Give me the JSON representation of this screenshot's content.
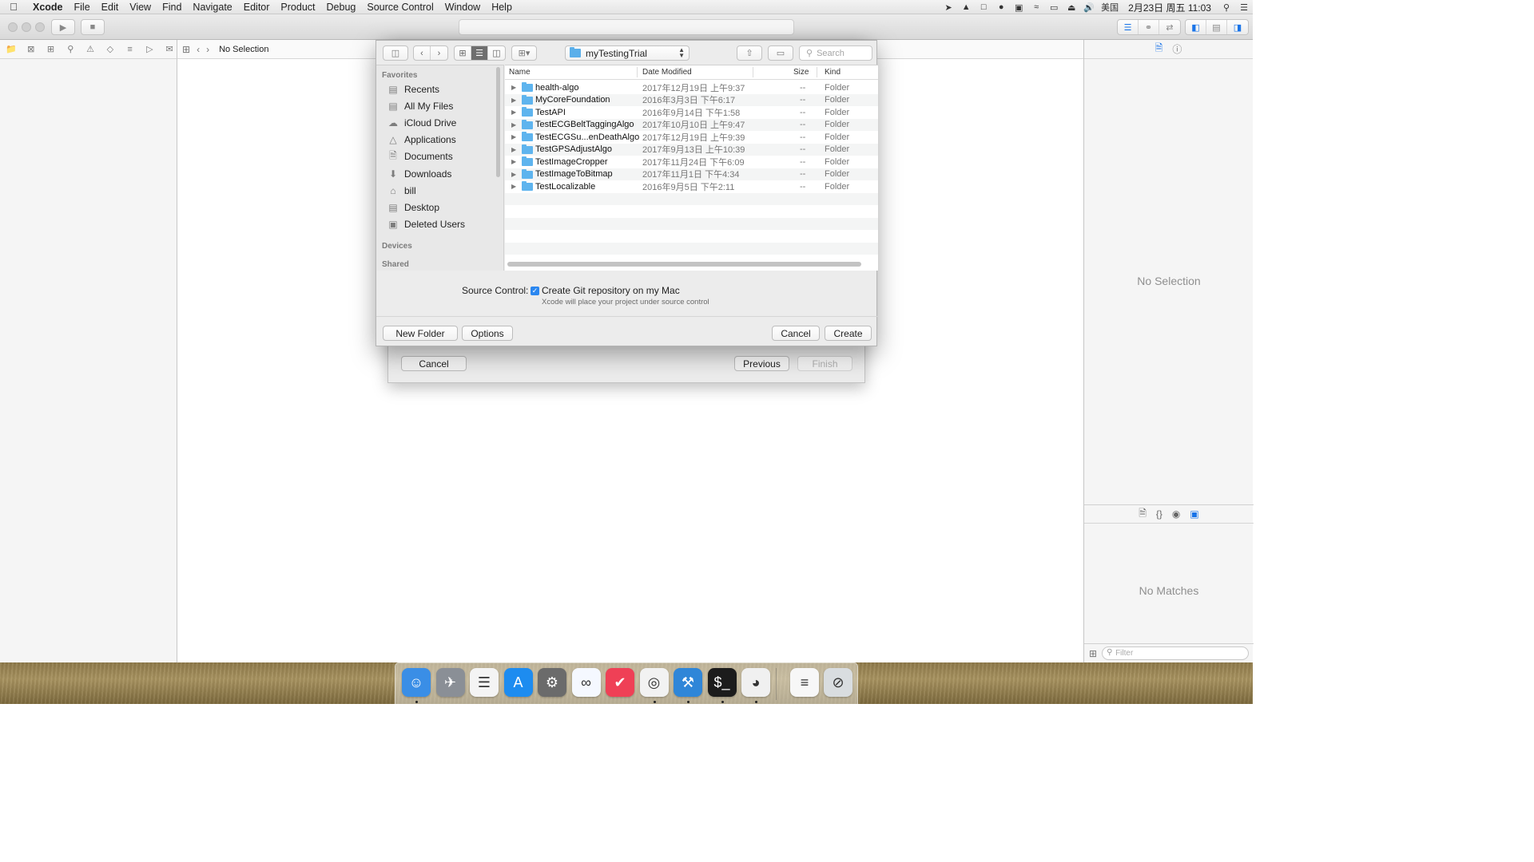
{
  "menubar": {
    "app_name": "Xcode",
    "items": [
      "File",
      "Edit",
      "View",
      "Find",
      "Navigate",
      "Editor",
      "Product",
      "Debug",
      "Source Control",
      "Window",
      "Help"
    ],
    "input_source": "美国",
    "clock": "2月23日 周五 11:03"
  },
  "jumpbar": {
    "label": "No Selection"
  },
  "inspector": {
    "no_selection": "No Selection",
    "no_matches": "No Matches",
    "filter_placeholder": "Filter"
  },
  "sheet": {
    "cancel": "Cancel",
    "previous": "Previous",
    "finish": "Finish"
  },
  "dialog": {
    "location": "myTestingTrial",
    "search_placeholder": "Search",
    "sidebar": {
      "favorites_header": "Favorites",
      "favorites": [
        {
          "label": "Recents",
          "icon": "recents-icon"
        },
        {
          "label": "All My Files",
          "icon": "all-files-icon"
        },
        {
          "label": "iCloud Drive",
          "icon": "cloud-icon"
        },
        {
          "label": "Applications",
          "icon": "applications-icon"
        },
        {
          "label": "Documents",
          "icon": "documents-icon"
        },
        {
          "label": "Downloads",
          "icon": "downloads-icon"
        },
        {
          "label": "bill",
          "icon": "home-icon"
        },
        {
          "label": "Desktop",
          "icon": "desktop-icon"
        },
        {
          "label": "Deleted Users",
          "icon": "folder-icon"
        }
      ],
      "devices_header": "Devices",
      "shared_header": "Shared"
    },
    "columns": {
      "name": "Name",
      "date": "Date Modified",
      "size": "Size",
      "kind": "Kind"
    },
    "files": [
      {
        "name": "health-algo",
        "date": "2017年12月19日 上午9:37",
        "size": "--",
        "kind": "Folder"
      },
      {
        "name": "MyCoreFoundation",
        "date": "2016年3月3日 下午6:17",
        "size": "--",
        "kind": "Folder"
      },
      {
        "name": "TestAPI",
        "date": "2016年9月14日 下午1:58",
        "size": "--",
        "kind": "Folder"
      },
      {
        "name": "TestECGBeltTaggingAlgo",
        "date": "2017年10月10日 上午9:47",
        "size": "--",
        "kind": "Folder"
      },
      {
        "name": "TestECGSu...enDeathAlgo",
        "date": "2017年12月19日 上午9:39",
        "size": "--",
        "kind": "Folder"
      },
      {
        "name": "TestGPSAdjustAlgo",
        "date": "2017年9月13日 上午10:39",
        "size": "--",
        "kind": "Folder"
      },
      {
        "name": "TestImageCropper",
        "date": "2017年11月24日 下午6:09",
        "size": "--",
        "kind": "Folder"
      },
      {
        "name": "TestImageToBitmap",
        "date": "2017年11月1日 下午4:34",
        "size": "--",
        "kind": "Folder"
      },
      {
        "name": "TestLocalizable",
        "date": "2016年9月5日 下午2:11",
        "size": "--",
        "kind": "Folder"
      }
    ],
    "source_control_label": "Source Control:",
    "create_git_label": "Create Git repository on my Mac",
    "create_git_checked": true,
    "source_control_note": "Xcode will place your project under source control",
    "new_folder": "New Folder",
    "options": "Options",
    "cancel": "Cancel",
    "create": "Create"
  },
  "dock": [
    {
      "name": "finder-icon",
      "color": "#3a8ee6"
    },
    {
      "name": "launchpad-icon",
      "color": "#8a8f96"
    },
    {
      "name": "reminders-icon",
      "color": "#f4f4f4"
    },
    {
      "name": "app-store-icon",
      "color": "#1d8cf0"
    },
    {
      "name": "system-preferences-icon",
      "color": "#6b6b6b"
    },
    {
      "name": "baidu-netdisk-icon",
      "color": "#f5f8ff"
    },
    {
      "name": "pocket-icon",
      "color": "#ef4056"
    },
    {
      "name": "chrome-icon",
      "color": "#f2f2f2"
    },
    {
      "name": "xcode-icon",
      "color": "#2f86d8"
    },
    {
      "name": "terminal-icon",
      "color": "#1c1c1c"
    },
    {
      "name": "qq-icon",
      "color": "#f0f0f0"
    },
    {
      "name": "document-icon",
      "color": "#f7f7f7"
    },
    {
      "name": "trash-icon",
      "color": "#d9dde0"
    }
  ]
}
